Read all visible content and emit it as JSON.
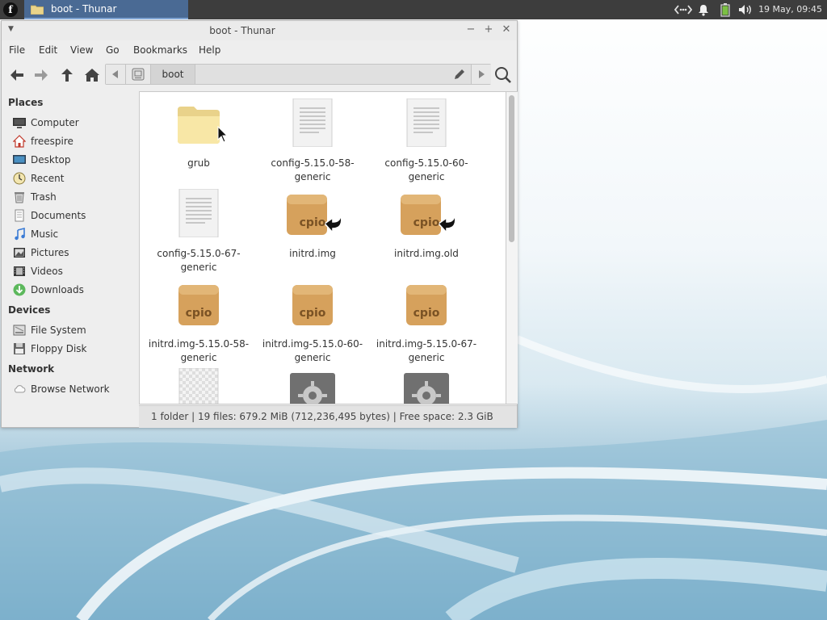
{
  "panel": {
    "menu_glyph": "f",
    "task_label": "boot - Thunar",
    "clock": "19 May, 09:45",
    "tray_icons": [
      "network-icon",
      "bell-icon",
      "battery-icon",
      "volume-icon"
    ]
  },
  "window": {
    "title": "boot - Thunar",
    "menus": [
      "File",
      "Edit",
      "View",
      "Go",
      "Bookmarks",
      "Help"
    ],
    "path_crumb": "boot"
  },
  "sidebar": {
    "places_heading": "Places",
    "places": [
      {
        "label": "Computer",
        "icon": "computer-icon"
      },
      {
        "label": "freespire",
        "icon": "home-icon"
      },
      {
        "label": "Desktop",
        "icon": "desktop-icon"
      },
      {
        "label": "Recent",
        "icon": "recent-icon"
      },
      {
        "label": "Trash",
        "icon": "trash-icon"
      },
      {
        "label": "Documents",
        "icon": "documents-icon"
      },
      {
        "label": "Music",
        "icon": "music-icon"
      },
      {
        "label": "Pictures",
        "icon": "pictures-icon"
      },
      {
        "label": "Videos",
        "icon": "videos-icon"
      },
      {
        "label": "Downloads",
        "icon": "downloads-icon"
      }
    ],
    "devices_heading": "Devices",
    "devices": [
      {
        "label": "File System",
        "icon": "drive-icon"
      },
      {
        "label": "Floppy Disk",
        "icon": "floppy-icon"
      }
    ],
    "network_heading": "Network",
    "network": [
      {
        "label": "Browse Network",
        "icon": "network-cloud-icon"
      }
    ]
  },
  "files": [
    {
      "line1": "grub",
      "line2": "",
      "type": "folder"
    },
    {
      "line1": "config-5.15.0-58-",
      "line2": "generic",
      "type": "text"
    },
    {
      "line1": "config-5.15.0-60-",
      "line2": "generic",
      "type": "text"
    },
    {
      "line1": "config-5.15.0-67-",
      "line2": "generic",
      "type": "text"
    },
    {
      "line1": "initrd.img",
      "line2": "",
      "type": "cpio-link"
    },
    {
      "line1": "initrd.img.old",
      "line2": "",
      "type": "cpio-link"
    },
    {
      "line1": "initrd.img-5.15.0-58-",
      "line2": "generic",
      "type": "cpio"
    },
    {
      "line1": "initrd.img-5.15.0-60-",
      "line2": "generic",
      "type": "cpio"
    },
    {
      "line1": "initrd.img-5.15.0-67-",
      "line2": "generic",
      "type": "cpio"
    },
    {
      "line1": "",
      "line2": "",
      "type": "image"
    },
    {
      "line1": "",
      "line2": "",
      "type": "executable"
    },
    {
      "line1": "",
      "line2": "",
      "type": "executable"
    }
  ],
  "cpio_text": "cpio",
  "status": "1 folder  |  19 files: 679.2 MiB (712,236,495 bytes)  |  Free space: 2.3 GiB",
  "colors": {
    "panel_bg": "#3d3d3d",
    "task_active": "#4a6a94",
    "folder_yellow": "#f5e18f",
    "cpio_brown": "#d9a95f"
  }
}
